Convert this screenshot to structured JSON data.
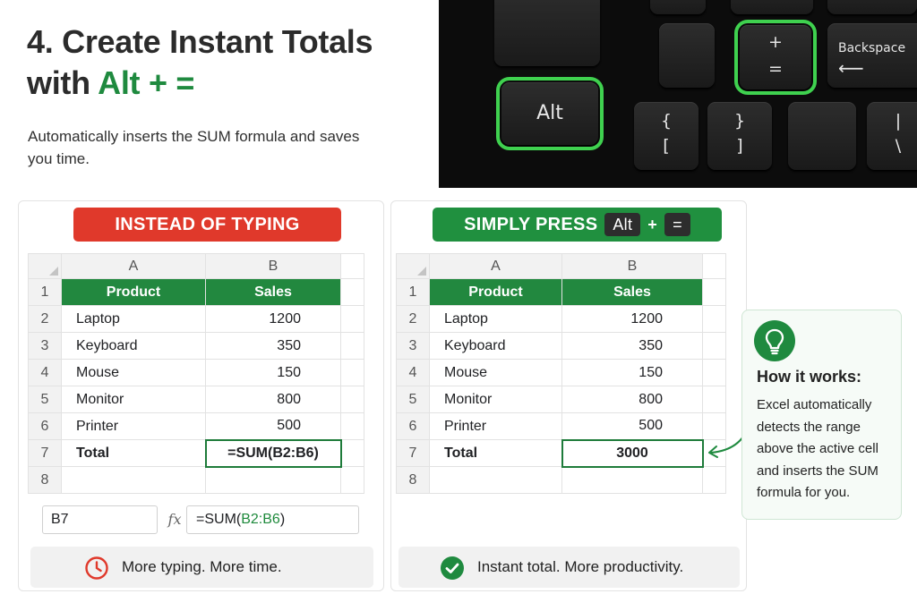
{
  "header": {
    "title_line1": "4. Create Instant Totals",
    "title_line2_prefix": "with ",
    "title_line2_highlight": "Alt + =",
    "subtitle": "Automatically inserts the SUM formula and saves you time."
  },
  "keyboard": {
    "alt_key": "Alt",
    "plus_key_top": "+",
    "plus_key_bottom": "=",
    "backspace_key": "Backspace",
    "backspace_arrow": "⟵",
    "brace_open_top": "{",
    "brace_open_bottom": "[",
    "brace_close_top": "}",
    "brace_close_bottom": "]",
    "pipe_top": "|",
    "pipe_bottom": "\\"
  },
  "left_panel": {
    "banner": "INSTEAD OF TYPING",
    "sheet": {
      "col_a": "A",
      "col_b": "B",
      "header_product": "Product",
      "header_sales": "Sales",
      "rows": [
        {
          "n": "1"
        },
        {
          "n": "2",
          "product": "Laptop",
          "sales": "1200"
        },
        {
          "n": "3",
          "product": "Keyboard",
          "sales": "350"
        },
        {
          "n": "4",
          "product": "Mouse",
          "sales": "150"
        },
        {
          "n": "5",
          "product": "Monitor",
          "sales": "800"
        },
        {
          "n": "6",
          "product": "Printer",
          "sales": "500"
        },
        {
          "n": "7",
          "product": "Total",
          "sales": "=SUM(B2:B6)"
        },
        {
          "n": "8"
        }
      ]
    },
    "formula_bar": {
      "name_box": "B7",
      "fx": "fx",
      "formula_prefix": "=SUM(",
      "formula_range": "B2:B6",
      "formula_suffix": ")"
    },
    "footer": "More typing. More time."
  },
  "right_panel": {
    "banner_text": "SIMPLY PRESS",
    "banner_key1": "Alt",
    "banner_plus": "+",
    "banner_key2": "=",
    "sheet": {
      "col_a": "A",
      "col_b": "B",
      "header_product": "Product",
      "header_sales": "Sales",
      "rows": [
        {
          "n": "1"
        },
        {
          "n": "2",
          "product": "Laptop",
          "sales": "1200"
        },
        {
          "n": "3",
          "product": "Keyboard",
          "sales": "350"
        },
        {
          "n": "4",
          "product": "Mouse",
          "sales": "150"
        },
        {
          "n": "5",
          "product": "Monitor",
          "sales": "800"
        },
        {
          "n": "6",
          "product": "Printer",
          "sales": "500"
        },
        {
          "n": "7",
          "product": "Total",
          "sales": "3000"
        },
        {
          "n": "8"
        }
      ]
    },
    "footer": "Instant total. More productivity."
  },
  "tip": {
    "title": "How it works:",
    "body": "Excel automatically detects the range above the active cell and inserts the SUM formula for you."
  },
  "colors": {
    "accent_green": "#1f8a3f",
    "alert_red": "#e0392b",
    "key_highlight": "#3fd14f"
  },
  "icons": [
    "lightbulb-icon",
    "clock-icon",
    "check-circle-icon",
    "curved-arrow-icon"
  ]
}
